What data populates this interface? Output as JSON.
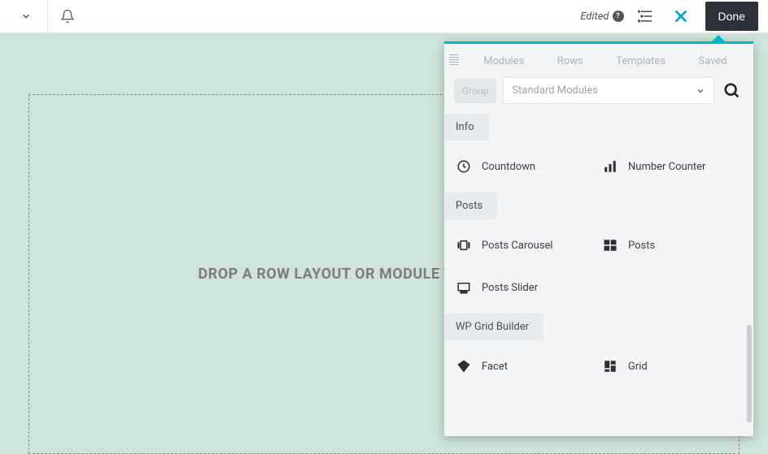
{
  "topbar": {
    "edited_label": "Edited",
    "done_label": "Done"
  },
  "canvas": {
    "dropzone_text": "DROP A ROW LAYOUT OR MODULE TO GET STARTED!"
  },
  "panel": {
    "tabs": {
      "modules": "Modules",
      "rows": "Rows",
      "templates": "Templates",
      "saved": "Saved"
    },
    "group_label": "Group",
    "select_value": "Standard Modules",
    "sections": [
      {
        "title": "Info",
        "modules": [
          {
            "icon": "clock",
            "label": "Countdown"
          },
          {
            "icon": "bars",
            "label": "Number Counter"
          }
        ]
      },
      {
        "title": "Posts",
        "modules": [
          {
            "icon": "carousel",
            "label": "Posts Carousel"
          },
          {
            "icon": "posts",
            "label": "Posts"
          },
          {
            "icon": "slider",
            "label": "Posts Slider"
          }
        ]
      },
      {
        "title": "WP Grid Builder",
        "modules": [
          {
            "icon": "diamond",
            "label": "Facet"
          },
          {
            "icon": "grid",
            "label": "Grid"
          }
        ]
      }
    ]
  }
}
